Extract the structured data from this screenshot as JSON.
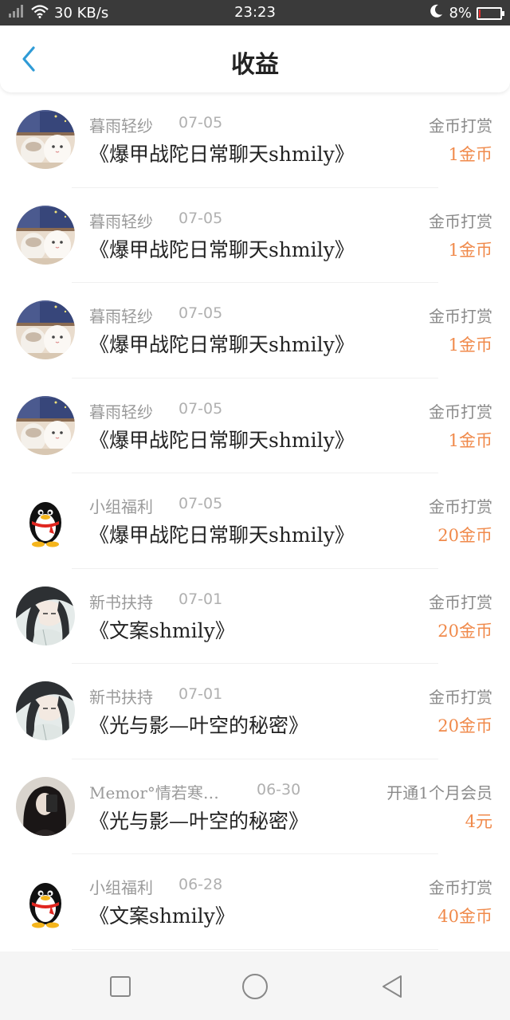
{
  "status_bar": {
    "signal_icon": "signal-icon",
    "wifi_icon": "wifi-icon",
    "speed": "30 KB/s",
    "time": "23:23",
    "moon_icon": "moon-icon",
    "battery": "8%",
    "battery_level": 0.08,
    "battery_color": "#e52b2b"
  },
  "header": {
    "back_icon": "back-arrow-icon",
    "title": "收益",
    "accent": "#2f9bd6"
  },
  "colors": {
    "amount": "#f08a4b"
  },
  "items": [
    {
      "avatar": "cat-avatar",
      "sender": "暮雨轻纱",
      "date": "07-05",
      "book": "《爆甲战陀日常聊天shmily》",
      "type": "金币打赏",
      "amount": "1金币"
    },
    {
      "avatar": "cat-avatar",
      "sender": "暮雨轻纱",
      "date": "07-05",
      "book": "《爆甲战陀日常聊天shmily》",
      "type": "金币打赏",
      "amount": "1金币"
    },
    {
      "avatar": "cat-avatar",
      "sender": "暮雨轻纱",
      "date": "07-05",
      "book": "《爆甲战陀日常聊天shmily》",
      "type": "金币打赏",
      "amount": "1金币"
    },
    {
      "avatar": "cat-avatar",
      "sender": "暮雨轻纱",
      "date": "07-05",
      "book": "《爆甲战陀日常聊天shmily》",
      "type": "金币打赏",
      "amount": "1金币"
    },
    {
      "avatar": "penguin-avatar",
      "sender": "小组福利",
      "date": "07-05",
      "book": "《爆甲战陀日常聊天shmily》",
      "type": "金币打赏",
      "amount": "20金币"
    },
    {
      "avatar": "anime-avatar",
      "sender": "新书扶持",
      "date": "07-01",
      "book": "《文案shmily》",
      "type": "金币打赏",
      "amount": "20金币"
    },
    {
      "avatar": "anime-avatar",
      "sender": "新书扶持",
      "date": "07-01",
      "book": "《光与影—叶空的秘密》",
      "type": "金币打赏",
      "amount": "20金币"
    },
    {
      "avatar": "photo-avatar",
      "sender": "Memor°情若寒…",
      "date": "06-30",
      "book": "《光与影—叶空的秘密》",
      "type": "开通1个月会员",
      "amount": "4元"
    },
    {
      "avatar": "penguin-avatar",
      "sender": "小组福利",
      "date": "06-28",
      "book": "《文案shmily》",
      "type": "金币打赏",
      "amount": "40金币"
    }
  ],
  "nav_bar": {
    "recent_icon": "square-icon",
    "home_icon": "circle-icon",
    "back_icon": "triangle-back-icon"
  }
}
